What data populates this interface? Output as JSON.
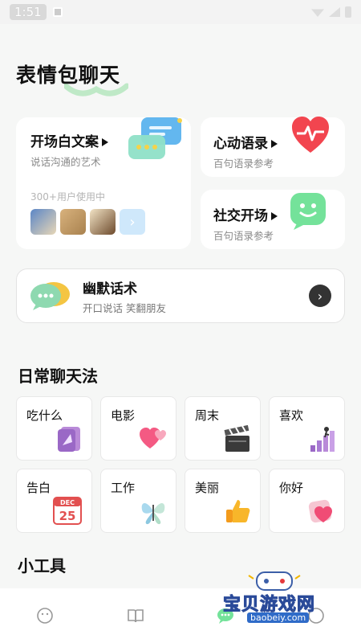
{
  "status_bar": {
    "time": "1:51"
  },
  "header": {
    "title": "表情包聊天"
  },
  "cards": {
    "opening": {
      "title": "开场白文案",
      "subtitle": "说话沟通的艺术",
      "users": "300+用户使用中",
      "more": "›"
    },
    "heart": {
      "title": "心动语录",
      "subtitle": "百句语录参考"
    },
    "social": {
      "title": "社交开场",
      "subtitle": "百句语录参考"
    },
    "humor": {
      "title": "幽默话术",
      "subtitle": "开口说话 笑翻朋友",
      "arrow": "›"
    }
  },
  "daily": {
    "title": "日常聊天法",
    "items": [
      {
        "label": "吃什么",
        "icon": "food-card-icon"
      },
      {
        "label": "电影",
        "icon": "hearts-icon"
      },
      {
        "label": "周末",
        "icon": "clapperboard-icon"
      },
      {
        "label": "喜欢",
        "icon": "climbing-chart-icon"
      },
      {
        "label": "告白",
        "icon": "calendar-icon"
      },
      {
        "label": "工作",
        "icon": "butterfly-icon"
      },
      {
        "label": "美丽",
        "icon": "thumbs-up-icon"
      },
      {
        "label": "你好",
        "icon": "heart-frame-icon"
      }
    ],
    "calendar_month": "DEC",
    "calendar_day": "25"
  },
  "tools": {
    "title": "小工具"
  },
  "bottom_nav": [
    "smile-face-icon",
    "book-icon",
    "chat-icon",
    "profile-icon"
  ],
  "watermark": {
    "text": "宝贝游戏网",
    "url": "baobeiy.com"
  },
  "colors": {
    "accent_green": "#74e29a",
    "bubble_blue": "#63b7ef",
    "heart_red": "#f2454f",
    "watermark_yellow": "#f2b600"
  }
}
